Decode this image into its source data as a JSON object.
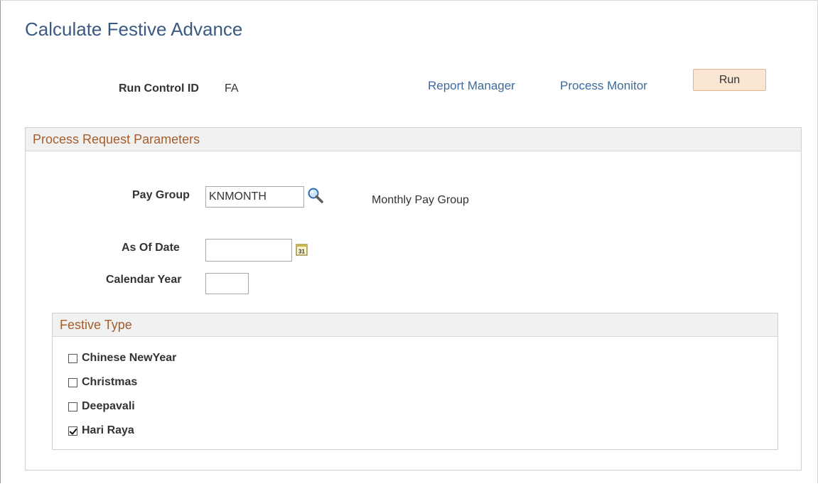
{
  "page": {
    "title": "Calculate Festive Advance"
  },
  "run_control": {
    "label": "Run Control ID",
    "value": "FA"
  },
  "links": {
    "report_manager": "Report Manager",
    "process_monitor": "Process Monitor"
  },
  "run_button": {
    "label": "Run"
  },
  "parameters": {
    "header": "Process Request Parameters",
    "pay_group": {
      "label": "Pay Group",
      "value": "KNMONTH",
      "description": "Monthly Pay Group",
      "icon": "lookup-icon"
    },
    "as_of_date": {
      "label": "As Of Date",
      "value": "",
      "icon": "calendar-icon"
    },
    "calendar_year": {
      "label": "Calendar Year",
      "value": ""
    },
    "festive_type": {
      "header": "Festive Type",
      "items": [
        {
          "label": "Chinese NewYear",
          "checked": false
        },
        {
          "label": "Christmas",
          "checked": false
        },
        {
          "label": "Deepavali",
          "checked": false
        },
        {
          "label": "Hari Raya",
          "checked": true
        }
      ]
    }
  },
  "colors": {
    "title": "#3b5a82",
    "link": "#3e6a9c",
    "section_header": "#a45d2c",
    "run_button_bg": "#fbe6d3"
  }
}
